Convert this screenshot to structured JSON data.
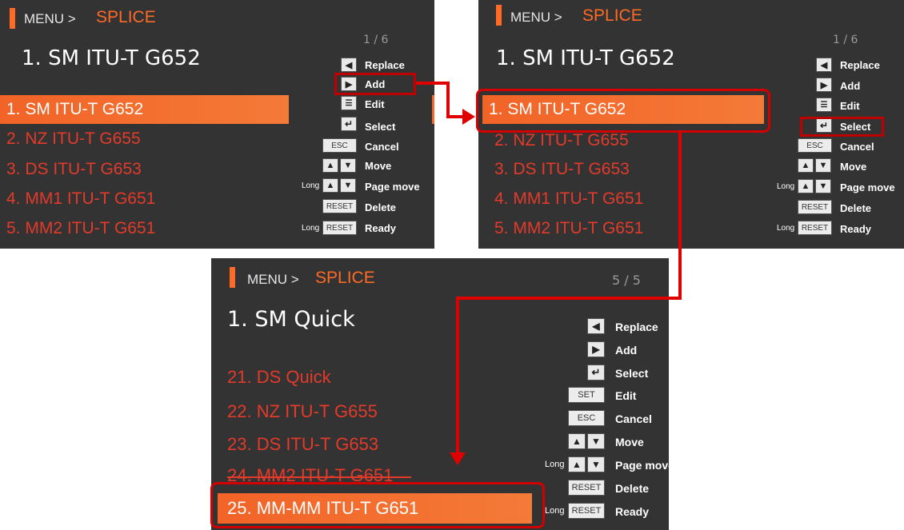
{
  "screens": [
    {
      "breadcrumb_menu": "MENU >",
      "breadcrumb_section": "SPLICE",
      "page": "1 / 6",
      "title": "1. SM ITU-T G652",
      "items": [
        "1. SM ITU-T G652",
        "2. NZ ITU-T G655",
        "3. DS ITU-T G653",
        "4. MM1 ITU-T G651",
        "5. MM2 ITU-T G651"
      ],
      "selected_index": 0,
      "keys": [
        "Replace",
        "Add",
        "Edit",
        "Select",
        "Cancel",
        "Move",
        "Page move",
        "Delete",
        "Ready"
      ],
      "highlighted_key": "Add"
    },
    {
      "breadcrumb_menu": "MENU >",
      "breadcrumb_section": "SPLICE",
      "page": "1 / 6",
      "title": "1. SM ITU-T G652",
      "items": [
        "1. SM ITU-T G652",
        "2. NZ ITU-T G655",
        "3. DS ITU-T G653",
        "4. MM1 ITU-T G651",
        "5. MM2 ITU-T G651"
      ],
      "selected_index": 0,
      "keys": [
        "Replace",
        "Add",
        "Edit",
        "Select",
        "Cancel",
        "Move",
        "Page move",
        "Delete",
        "Ready"
      ],
      "highlighted_key": "Select"
    },
    {
      "breadcrumb_menu": "MENU >",
      "breadcrumb_section": "SPLICE",
      "page": "5 / 5",
      "title": "1. SM Quick",
      "items": [
        "21. DS Quick",
        "22. NZ ITU-T G655",
        "23. DS ITU-T G653",
        "24. MM2 ITU-T G651",
        "25. MM-MM ITU-T G651"
      ],
      "selected_index": 4,
      "keys": [
        "Replace",
        "Add",
        "Select",
        "Edit",
        "Cancel",
        "Move",
        "Page move",
        "Delete",
        "Ready"
      ]
    }
  ],
  "key_caps": {
    "esc": "ESC",
    "set": "SET",
    "reset": "RESET",
    "long": "Long"
  },
  "colors": {
    "panel_bg": "#333333",
    "accent_orange": "#ff6a26",
    "item_red": "#e33a2a",
    "highlight_red": "#d40000"
  }
}
